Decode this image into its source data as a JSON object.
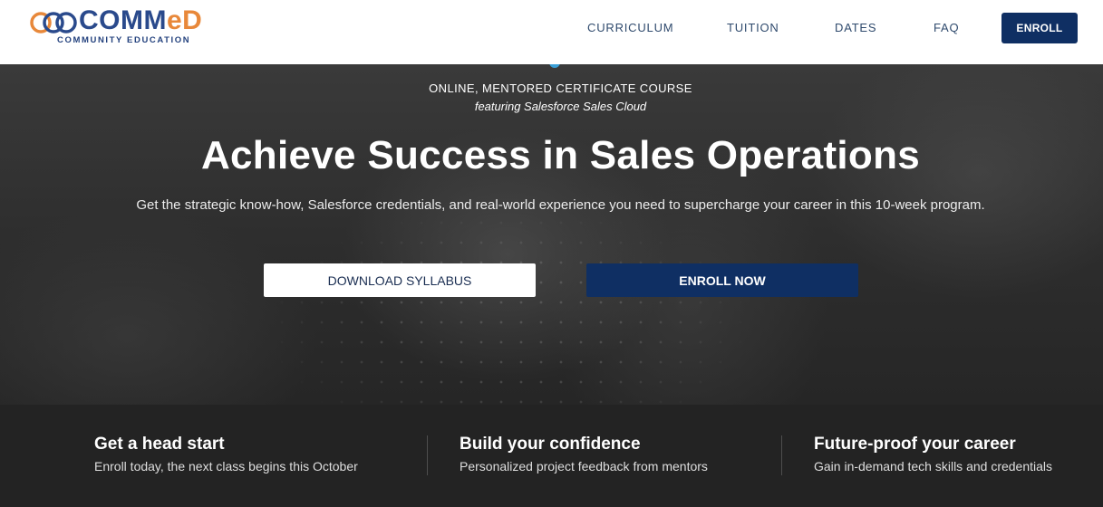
{
  "header": {
    "logo_main": "COMM",
    "logo_accent": "eD",
    "logo_sub": "COMMUNITY EDUCATION",
    "nav": [
      "CURRICULUM",
      "TUITION",
      "DATES",
      "FAQ"
    ],
    "enroll_label": "ENROLL"
  },
  "hero": {
    "eyebrow": "ONLINE, MENTORED CERTIFICATE COURSE",
    "eyebrow_featuring": "featuring Salesforce Sales Cloud",
    "title": "Achieve Success in Sales Operations",
    "subtitle": "Get the strategic know-how, Salesforce credentials, and real-world experience you need to supercharge your career in this 10-week program.",
    "download_label": "DOWNLOAD SYLLABUS",
    "enroll_now_label": "ENROLL NOW"
  },
  "features": [
    {
      "title": "Get a head start",
      "text": "Enroll today, the next class begins this October"
    },
    {
      "title": "Build your confidence",
      "text": "Personalized project feedback from mentors"
    },
    {
      "title": "Future-proof your career",
      "text": "Gain in-demand tech skills and credentials"
    }
  ],
  "colors": {
    "navy": "#0f2f63",
    "logo_blue": "#2a4a8c",
    "logo_orange": "#e8883a",
    "nav_text": "#2f4a6d"
  }
}
